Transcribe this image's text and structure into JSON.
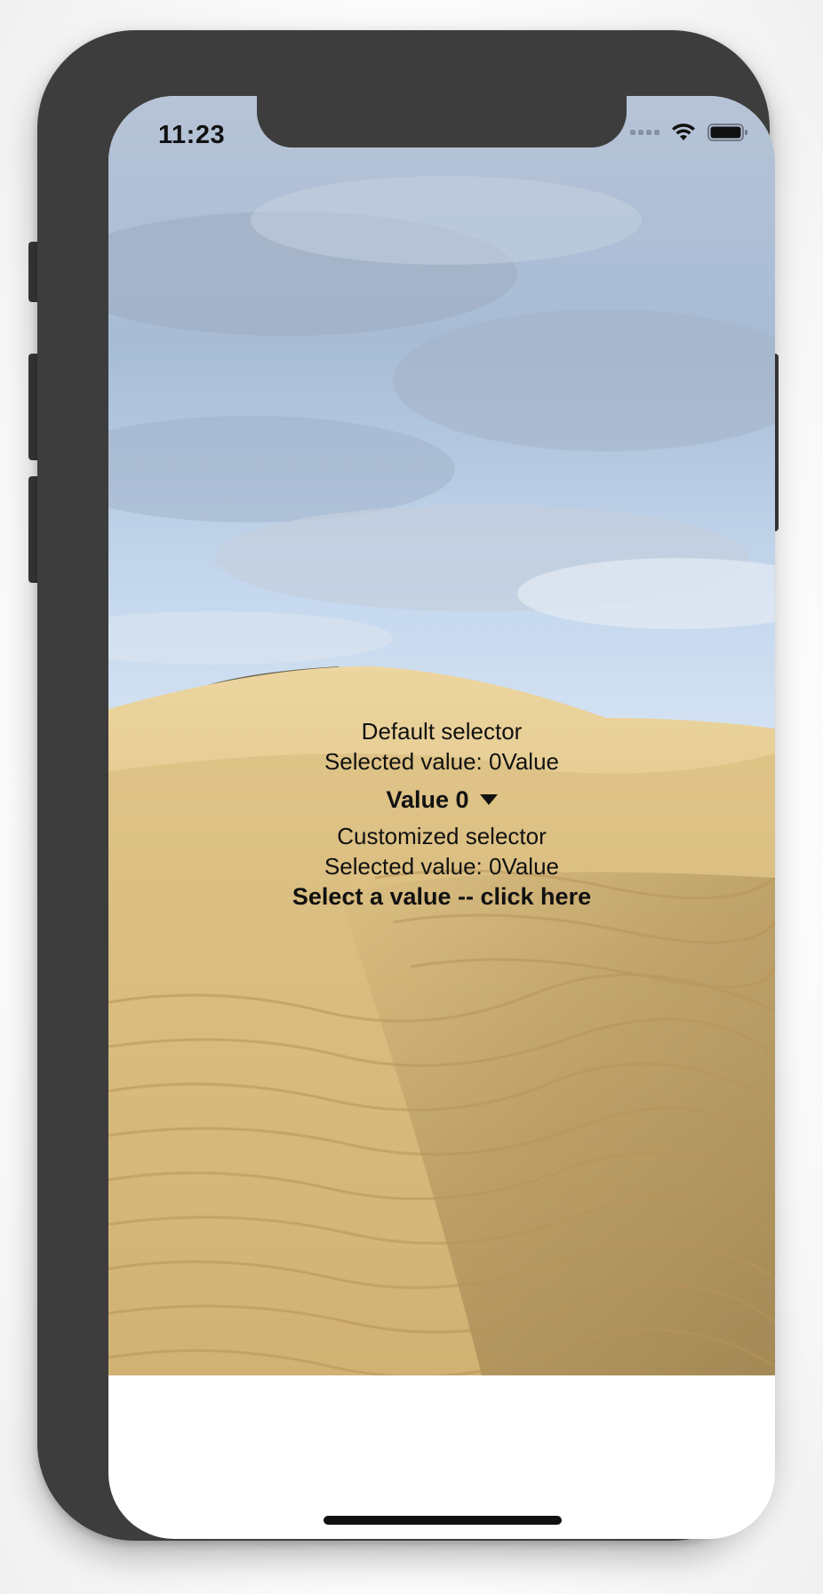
{
  "status_bar": {
    "time": "11:23",
    "icons": [
      "signal-icon",
      "wifi-icon",
      "battery-icon"
    ]
  },
  "default_section": {
    "title": "Default selector",
    "selected_text": "Selected value: 0Value",
    "selector_label": "Value 0"
  },
  "custom_section": {
    "title": "Customized selector",
    "selected_text": "Selected value: 0Value",
    "selector_label": "Select a value -- click here"
  },
  "colors": {
    "phone_frame": "#3d3d3d",
    "text": "#111111",
    "sky": "#a9c4e4",
    "sand": "#d9bd80"
  }
}
